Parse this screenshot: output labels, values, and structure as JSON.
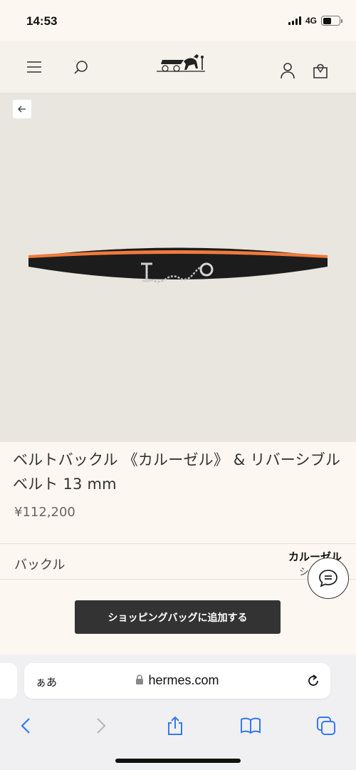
{
  "status": {
    "time": "14:53",
    "network": "4G"
  },
  "product": {
    "title": "ベルトバックル 《カルーゼル》 & リバーシブルベルト 13 mm",
    "price": "¥112,200"
  },
  "options": {
    "label": "バックル",
    "value": "カルーゼル",
    "sub": "シ"
  },
  "actions": {
    "add_to_cart": "ショッピングバッグに追加する"
  },
  "browser": {
    "aa": "ぁあ",
    "url": "hermes.com"
  },
  "colors": {
    "accent": "#333333",
    "belt_inner": "#e8642a",
    "belt_outer": "#1a1a1a",
    "link_blue": "#3478f6"
  }
}
